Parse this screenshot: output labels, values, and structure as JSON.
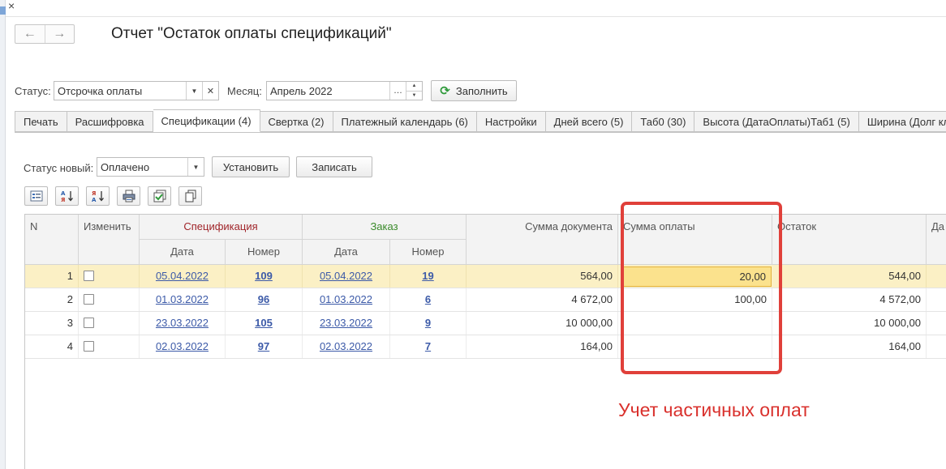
{
  "window": {
    "title": "Отчет \"Остаток оплаты спецификаций\"",
    "close_glyph": "×"
  },
  "filters": {
    "status_label": "Статус:",
    "status_value": "Отсрочка оплаты",
    "month_label": "Месяц:",
    "month_value": "Апрель 2022",
    "fill_button": "Заполнить"
  },
  "tabs": [
    {
      "label": "Печать"
    },
    {
      "label": "Расшифровка"
    },
    {
      "label": "Спецификации (4)",
      "active": true
    },
    {
      "label": "Свертка (2)"
    },
    {
      "label": "Платежный календарь (6)"
    },
    {
      "label": "Настройки"
    },
    {
      "label": "Дней всего (5)"
    },
    {
      "label": "Таб0 (30)"
    },
    {
      "label": "Высота (ДатаОплаты)Таб1 (5)"
    },
    {
      "label": "Ширина (Долг клиен"
    }
  ],
  "status_panel": {
    "label": "Статус новый:",
    "value": "Оплачено",
    "set_button": "Установить",
    "write_button": "Записать"
  },
  "toolbar_icons": [
    "list-icon",
    "sort-ascending-icon",
    "sort-descending-icon",
    "print-settings-icon",
    "check-all-icon",
    "copy-icon"
  ],
  "table": {
    "headers": {
      "n": "N",
      "edit": "Изменить",
      "spec": "Спецификация",
      "order": "Заказ",
      "date": "Дата",
      "number": "Номер",
      "doc_sum": "Сумма документа",
      "pay_sum": "Сумма оплаты",
      "rest": "Остаток",
      "next": "Да"
    },
    "rows": [
      {
        "n": "1",
        "spec_date": "05.04.2022",
        "spec_num": "109",
        "order_date": "05.04.2022",
        "order_num": "19",
        "doc_sum": "564,00",
        "pay_sum": "20,00",
        "rest": "544,00"
      },
      {
        "n": "2",
        "spec_date": "01.03.2022",
        "spec_num": "96",
        "order_date": "01.03.2022",
        "order_num": "6",
        "doc_sum": "4 672,00",
        "pay_sum": "100,00",
        "rest": "4 572,00"
      },
      {
        "n": "3",
        "spec_date": "23.03.2022",
        "spec_num": "105",
        "order_date": "23.03.2022",
        "order_num": "9",
        "doc_sum": "10 000,00",
        "pay_sum": "",
        "rest": "10 000,00"
      },
      {
        "n": "4",
        "spec_date": "02.03.2022",
        "spec_num": "97",
        "order_date": "02.03.2022",
        "order_num": "7",
        "doc_sum": "164,00",
        "pay_sum": "",
        "rest": "164,00"
      }
    ]
  },
  "annotation": {
    "text": "Учет частичных оплат",
    "color": "#d9302c"
  },
  "colors": {
    "spec_header": "#a0252a",
    "order_header": "#3a8a2a",
    "link": "#3c5aa8",
    "selected_row": "#fbf0c5"
  }
}
